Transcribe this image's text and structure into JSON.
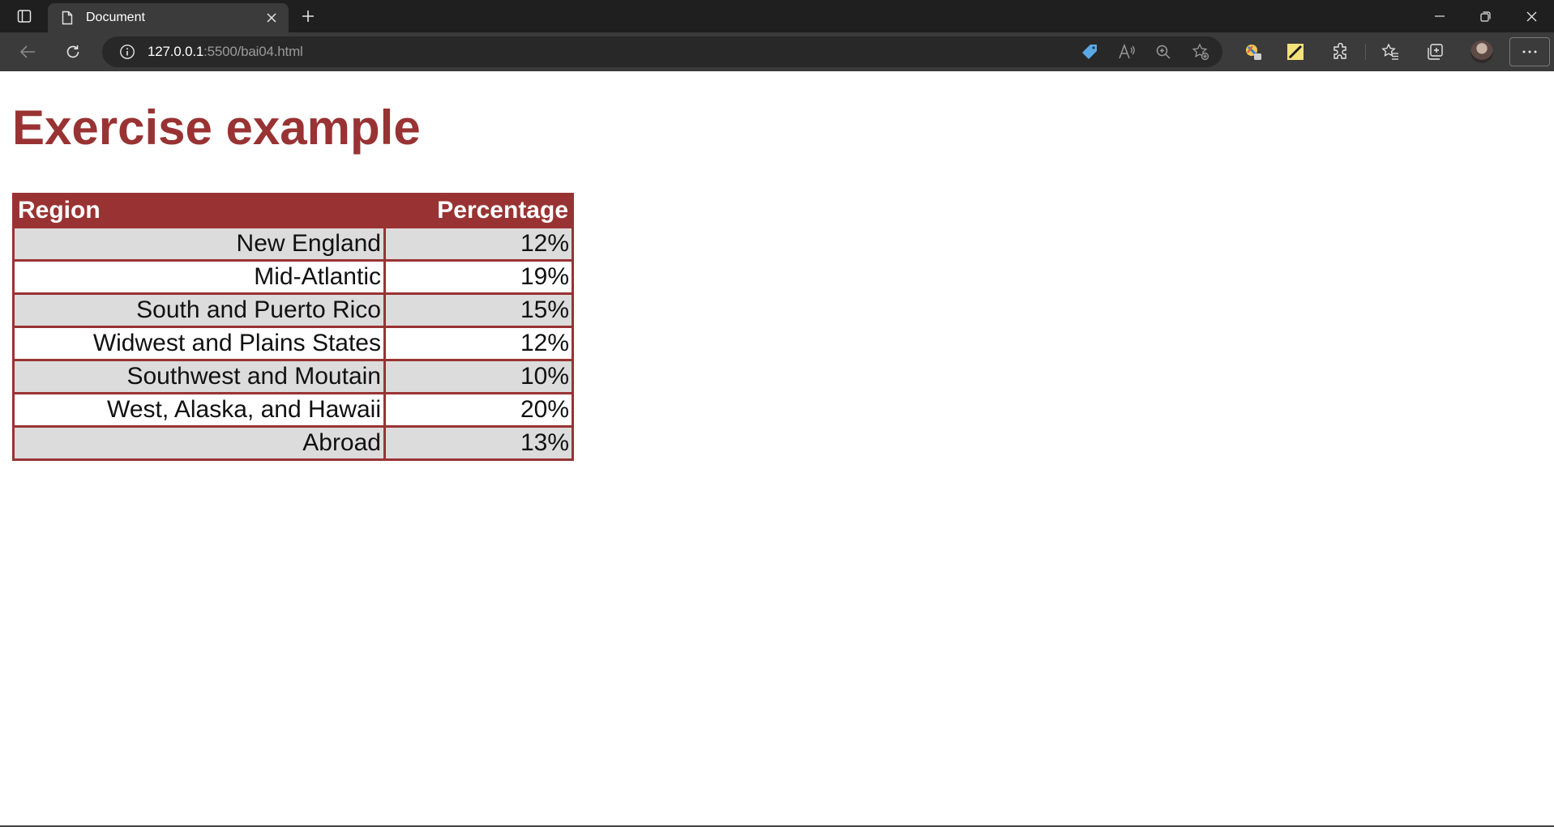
{
  "browser": {
    "tab": {
      "title": "Document"
    },
    "address_bar": {
      "url_host": "127.0.0.1",
      "url_rest": ":5500/bai04.html"
    },
    "icons": {
      "tab_actions": "vertical-tabs-icon",
      "tab_page": "document-icon",
      "tab_close": "close-icon",
      "new_tab": "plus-icon",
      "back": "back-arrow-icon",
      "refresh": "refresh-icon",
      "site_info": "info-icon",
      "coupon": "tag-icon",
      "read_aloud": "read-aloud-icon",
      "zoom": "zoom-icon",
      "add_favorite": "add-favorite-icon",
      "extension_a": "extension-colorful-icon",
      "extension_b": "extension-pen-icon",
      "extensions": "puzzle-icon",
      "favorites": "favorites-icon",
      "collections": "collections-icon",
      "profile": "avatar",
      "more": "ellipsis-icon",
      "minimize": "minimize-icon",
      "restore": "restore-icon",
      "close_window": "close-icon"
    },
    "colors": {
      "chrome_dark": "#1f1f1f",
      "toolbar": "#3b3b3b",
      "omnibox": "#282828"
    }
  },
  "page": {
    "title": "Exercise example",
    "colors": {
      "accent": "#993333",
      "odd_row": "#dcdcdc",
      "even_row": "#ffffff"
    },
    "table": {
      "headers": {
        "region": "Region",
        "percentage": "Percentage"
      },
      "rows": [
        {
          "region": "New England",
          "percentage": "12%"
        },
        {
          "region": "Mid-Atlantic",
          "percentage": "19%"
        },
        {
          "region": "South and Puerto Rico",
          "percentage": "15%"
        },
        {
          "region": "Widwest and Plains States",
          "percentage": "12%"
        },
        {
          "region": "Southwest and Moutain",
          "percentage": "10%"
        },
        {
          "region": "West, Alaska, and Hawaii",
          "percentage": "20%"
        },
        {
          "region": "Abroad",
          "percentage": "13%"
        }
      ]
    }
  }
}
